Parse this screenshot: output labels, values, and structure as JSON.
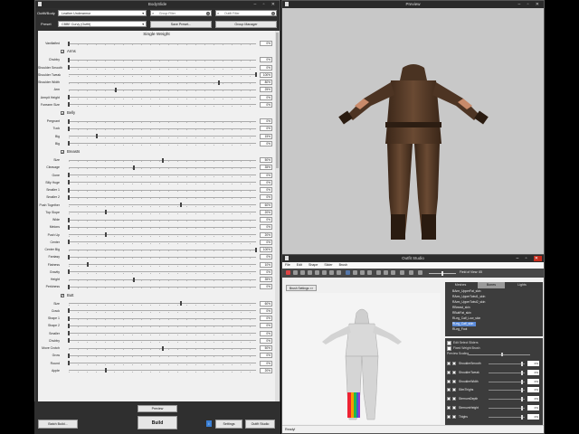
{
  "bodyslide": {
    "title": "BodySlide",
    "outfit_body_label": "Outfit/Body",
    "outfit_body_value": "Leather Underarmor",
    "group_filter_placeholder": "Group Filter",
    "outfit_filter_placeholder": "Outfit Filter",
    "preset_label": "Preset",
    "preset_value": "CBBE Curvy (Outfit)",
    "save_preset": "Save Preset...",
    "group_manager": "Group Manager",
    "buttons": {
      "preview": "Preview",
      "batch_build": "Batch Build...",
      "build": "Build",
      "settings": "Settings",
      "outfit_studio": "Outfit Studio"
    },
    "sections": [
      {
        "label": "Single Weight",
        "checkbox": false,
        "sliders": [
          {
            "name": "Vanillafied",
            "value": 0,
            "text": "0%"
          }
        ]
      },
      {
        "label": "Arms",
        "checkbox": true,
        "sliders": [
          {
            "name": "Chubby",
            "value": 0,
            "text": "0%"
          },
          {
            "name": "Shoulder Smooth",
            "value": 0,
            "text": "0%"
          },
          {
            "name": "Shoulder Tweak",
            "value": 100,
            "text": "100%"
          },
          {
            "name": "Shoulder Width",
            "value": 80,
            "text": "80%"
          },
          {
            "name": "Arm",
            "value": 25,
            "text": "25%"
          },
          {
            "name": "Armpit Height",
            "value": 0,
            "text": "0%"
          },
          {
            "name": "Forearm Size",
            "value": 0,
            "text": "0%"
          }
        ]
      },
      {
        "label": "Belly",
        "checkbox": true,
        "sliders": [
          {
            "name": "Pregnant",
            "value": 0,
            "text": "0%"
          },
          {
            "name": "Tuck",
            "value": 0,
            "text": "0%"
          },
          {
            "name": "Big",
            "value": 15,
            "text": "15%"
          },
          {
            "name": "Big",
            "value": 0,
            "text": "0%"
          }
        ]
      },
      {
        "label": "Breasts",
        "checkbox": true,
        "sliders": [
          {
            "name": "Size",
            "value": 50,
            "text": "50%"
          },
          {
            "name": "Cleavage",
            "value": 35,
            "text": "35%"
          },
          {
            "name": "Gone",
            "value": 0,
            "text": "0%"
          },
          {
            "name": "Silly Huge",
            "value": 0,
            "text": "0%"
          },
          {
            "name": "Smaller 1",
            "value": 0,
            "text": "0%"
          },
          {
            "name": "Smaller 2",
            "value": 0,
            "text": "0%"
          },
          {
            "name": "Push Together",
            "value": 60,
            "text": "60%"
          },
          {
            "name": "Top Slope",
            "value": 20,
            "text": "20%"
          },
          {
            "name": "Wide",
            "value": 0,
            "text": "0%"
          },
          {
            "name": "Melons",
            "value": 0,
            "text": "0%"
          },
          {
            "name": "Push Up",
            "value": 20,
            "text": "20%"
          },
          {
            "name": "Center",
            "value": 0,
            "text": "0%"
          },
          {
            "name": "Center Big",
            "value": 100,
            "text": "100%"
          },
          {
            "name": "Fantasy",
            "value": 0,
            "text": "0%"
          },
          {
            "name": "Flatness",
            "value": 10,
            "text": "10%"
          },
          {
            "name": "Gravity",
            "value": 0,
            "text": "0%"
          },
          {
            "name": "Height",
            "value": 35,
            "text": "35%"
          },
          {
            "name": "Perkiness",
            "value": 0,
            "text": "0%"
          }
        ]
      },
      {
        "label": "Butt",
        "checkbox": true,
        "sliders": [
          {
            "name": "Size",
            "value": 60,
            "text": "60%"
          },
          {
            "name": "Crack",
            "value": 0,
            "text": "0%"
          },
          {
            "name": "Shape 1",
            "value": 0,
            "text": "0%"
          },
          {
            "name": "Shape 2",
            "value": 0,
            "text": "0%"
          },
          {
            "name": "Smaller",
            "value": 0,
            "text": "0%"
          },
          {
            "name": "Chubby",
            "value": 0,
            "text": "0%"
          },
          {
            "name": "Move Crotch",
            "value": 50,
            "text": "50%"
          },
          {
            "name": "Grow",
            "value": 0,
            "text": "0%"
          },
          {
            "name": "Round",
            "value": 0,
            "text": "0%"
          },
          {
            "name": "Apple",
            "value": 20,
            "text": "20%"
          }
        ]
      }
    ]
  },
  "preview": {
    "title": "Preview"
  },
  "outfit_studio": {
    "title": "Outfit Studio",
    "menu": [
      "File",
      "Edit",
      "Shape",
      "Slider",
      "Brush"
    ],
    "field_of_view": "Field of View: 65",
    "brush_settings": "Brush Settings >>",
    "tabs": [
      "Meshes",
      "Bones",
      "Lights"
    ],
    "active_tab": "Bones",
    "bones": [
      "BArm_UpperFat_skin",
      "RArm_UpperTwist1_skin",
      "RArm_UpperTwist2_skin",
      "RBreast_skin",
      "RButtFat_skin",
      "RLeg_Calf_Low_skin",
      "RLeg_Calf_skin",
      "RLeg_Foot"
    ],
    "selected_bone": "RLeg_Calf_skin",
    "edit_select_sliders": "Edit Select Sliders",
    "fixed_weight_brush": "Fixed Weight Brush",
    "preview_scaling": "Preview Scaling",
    "sliders": [
      {
        "name": "ShoulderSmooth",
        "text": "0%"
      },
      {
        "name": "ShoulderTweak",
        "text": "0%"
      },
      {
        "name": "ShoulderWidth",
        "text": "0%"
      },
      {
        "name": "SlimThighs",
        "text": "0%"
      },
      {
        "name": "SternumDepth",
        "text": "0%"
      },
      {
        "name": "SternumHeight",
        "text": "0%"
      },
      {
        "name": "Thighs",
        "text": "0%"
      }
    ],
    "status": "Ready!"
  }
}
